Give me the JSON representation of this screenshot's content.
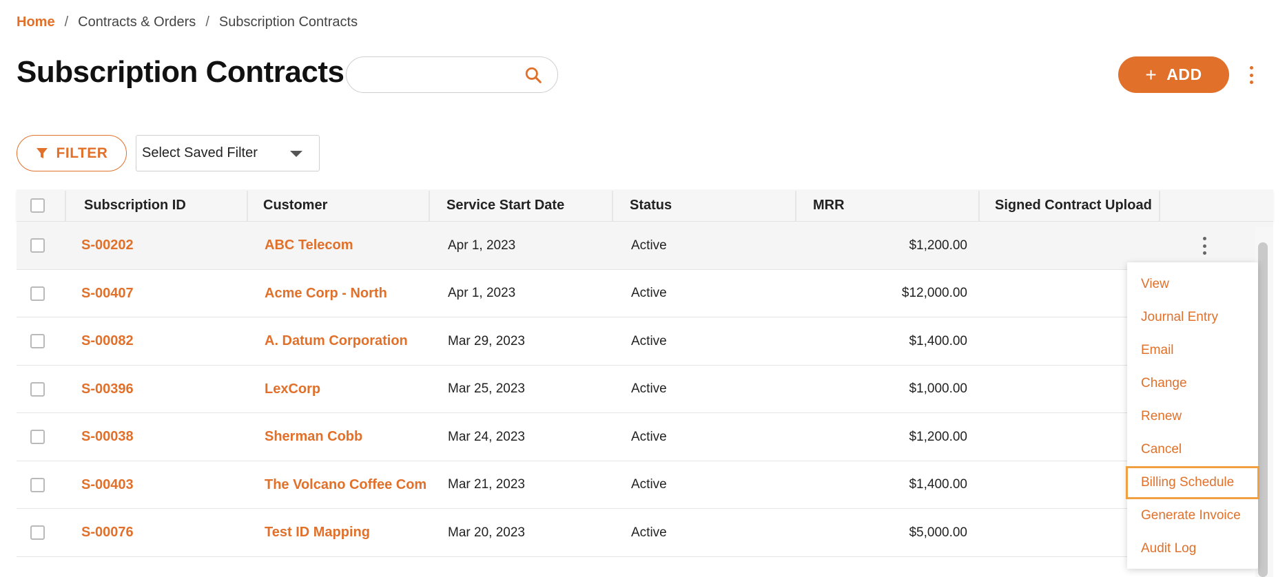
{
  "breadcrumb": {
    "home": "Home",
    "level2": "Contracts & Orders",
    "current": "Subscription Contracts",
    "separator": "/"
  },
  "header": {
    "title": "Subscription Contracts",
    "search_value": "",
    "search_placeholder": "",
    "add_label": "ADD",
    "add_icon": "plus-icon"
  },
  "toolbar": {
    "filter_label": "FILTER",
    "filter_icon": "funnel-icon",
    "saved_filter_value": "Select Saved Filter"
  },
  "table": {
    "columns": [
      "Subscription ID",
      "Customer",
      "Service Start Date",
      "Status",
      "MRR",
      "Signed Contract Upload"
    ],
    "rows": [
      {
        "id": "S-00202",
        "customer": "ABC Telecom",
        "start": "Apr 1, 2023",
        "status": "Active",
        "mrr": "$1,200.00",
        "upload": ""
      },
      {
        "id": "S-00407",
        "customer": "Acme Corp - North",
        "start": "Apr 1, 2023",
        "status": "Active",
        "mrr": "$12,000.00",
        "upload": ""
      },
      {
        "id": "S-00082",
        "customer": "A. Datum Corporation",
        "start": "Mar 29, 2023",
        "status": "Active",
        "mrr": "$1,400.00",
        "upload": ""
      },
      {
        "id": "S-00396",
        "customer": "LexCorp",
        "start": "Mar 25, 2023",
        "status": "Active",
        "mrr": "$1,000.00",
        "upload": ""
      },
      {
        "id": "S-00038",
        "customer": "Sherman Cobb",
        "start": "Mar 24, 2023",
        "status": "Active",
        "mrr": "$1,200.00",
        "upload": ""
      },
      {
        "id": "S-00403",
        "customer": "The Volcano Coffee Company",
        "start": "Mar 21, 2023",
        "status": "Active",
        "mrr": "$1,400.00",
        "upload": ""
      },
      {
        "id": "S-00076",
        "customer": "Test ID Mapping",
        "start": "Mar 20, 2023",
        "status": "Active",
        "mrr": "$5,000.00",
        "upload": ""
      }
    ]
  },
  "row_menu": {
    "items": [
      "View",
      "Journal Entry",
      "Email",
      "Change",
      "Renew",
      "Cancel",
      "Billing Schedule",
      "Generate Invoice",
      "Audit Log"
    ],
    "active": "Billing Schedule"
  },
  "colors": {
    "accent": "#e0702a",
    "active_outline": "#f0a040"
  }
}
